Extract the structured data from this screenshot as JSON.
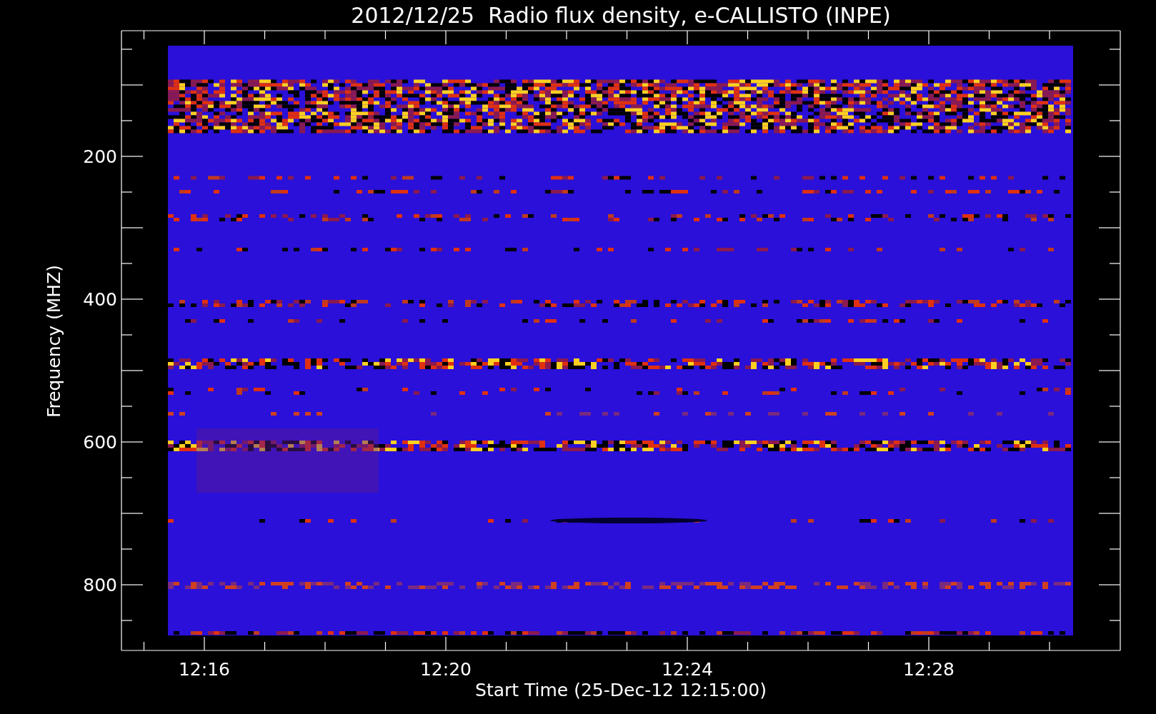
{
  "title": "2012/12/25  Radio flux density, e-CALLISTO (INPE)",
  "y_axis": {
    "label": "Frequency (MHZ)",
    "ticks": [
      "200",
      "400",
      "600",
      "800"
    ]
  },
  "x_axis": {
    "label": "Start Time (25-Dec-12 12:15:00)",
    "ticks": [
      "12:16",
      "12:20",
      "12:24",
      "12:28"
    ]
  }
}
